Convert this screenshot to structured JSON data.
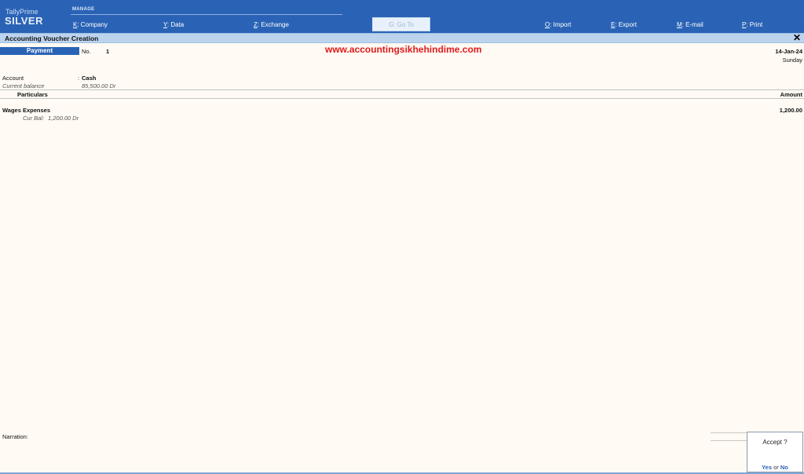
{
  "topbar": {
    "brand_small": "TallyPrime",
    "brand_big": "SILVER",
    "section": "MANAGE",
    "menu": {
      "company_key": "K",
      "company_label": ": Company",
      "data_key": "Y",
      "data_label": ": Data",
      "exchange_key": "Z",
      "exchange_label": ": Exchange",
      "goto_label": "G: Go To",
      "import_key": "O",
      "import_label": ": Import",
      "export_key": "E",
      "export_label": ": Export",
      "email_key": "M",
      "email_label": ": E-mail",
      "print_key": "P",
      "print_label": ": Print"
    }
  },
  "window": {
    "title": "Accounting Voucher Creation",
    "close_glyph": "✕"
  },
  "voucher": {
    "type": "Payment",
    "no_label": "No.",
    "no_value": "1",
    "date": "14-Jan-24",
    "day": "Sunday",
    "account_label": "Account",
    "account_value": "Cash",
    "current_balance_label": "Current balance",
    "current_balance_value": "85,500.00 Dr"
  },
  "watermark": "www.accountingsikhehindime.com",
  "table": {
    "col_particulars": "Particulars",
    "col_amount": "Amount",
    "rows": [
      {
        "ledger": "Wages Expenses",
        "cur_bal_label": "Cur Bal:",
        "cur_bal_value": "1,200.00 Dr",
        "amount": "1,200.00"
      }
    ]
  },
  "narration_label": "Narration:",
  "accept": {
    "question": "Accept ?",
    "yes": "Yes",
    "or": "or",
    "no": "No"
  },
  "colors": {
    "accent": "#2a63b5",
    "background": "#fffaf3",
    "watermark": "#e01a1a"
  }
}
